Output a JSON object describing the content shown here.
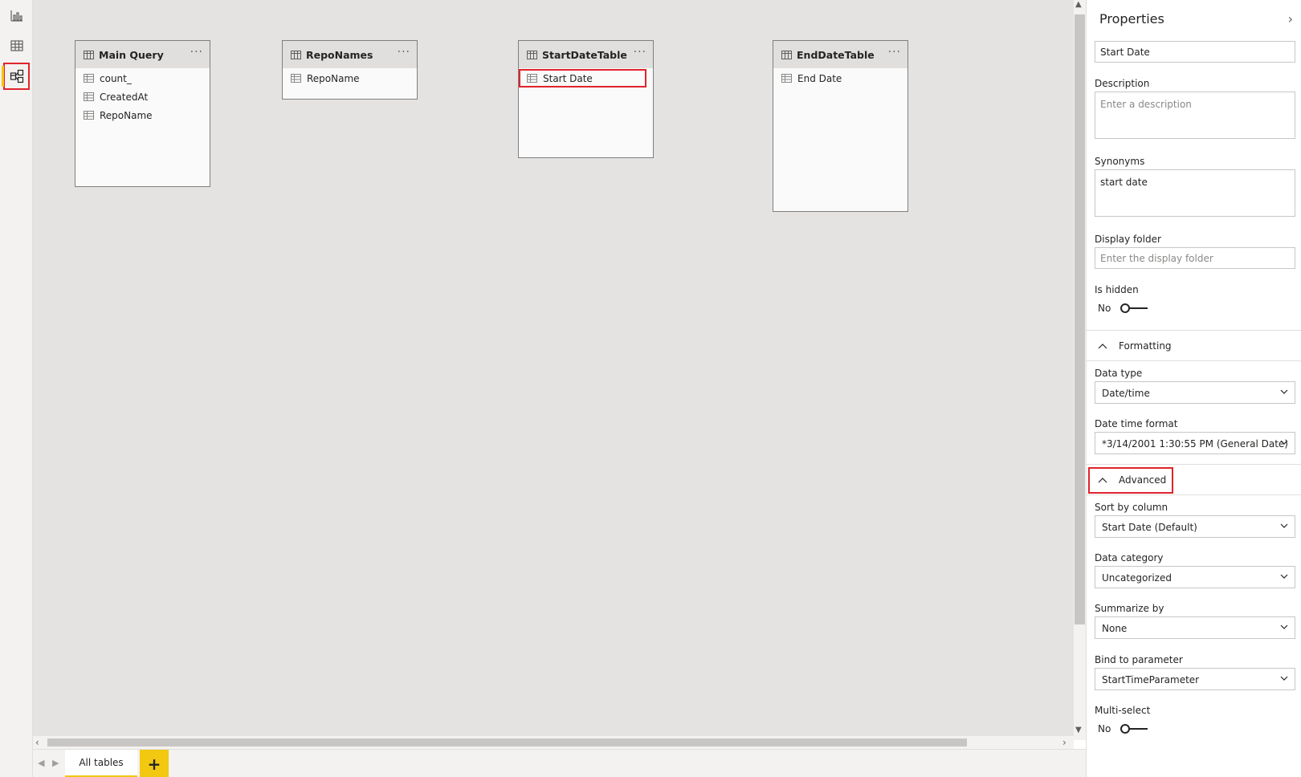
{
  "nav": {
    "items": [
      {
        "name": "report-view",
        "icon": "bar-chart-icon"
      },
      {
        "name": "data-view",
        "icon": "table-grid-icon"
      },
      {
        "name": "model-view",
        "icon": "model-diagram-icon",
        "active": true
      }
    ]
  },
  "tables": [
    {
      "name": "Main Query",
      "fields": [
        "count_",
        "CreatedAt",
        "RepoName"
      ]
    },
    {
      "name": "RepoNames",
      "fields": [
        "RepoName"
      ]
    },
    {
      "name": "StartDateTable",
      "fields": [
        "Start Date"
      ],
      "selected_field": "Start Date"
    },
    {
      "name": "EndDateTable",
      "fields": [
        "End Date"
      ]
    }
  ],
  "card_more_label": "···",
  "tabs": {
    "all_tables": "All tables",
    "add_label": "+"
  },
  "properties": {
    "title": "Properties",
    "name_value": "Start Date",
    "description_label": "Description",
    "description_placeholder": "Enter a description",
    "synonyms_label": "Synonyms",
    "synonyms_value": "start date",
    "display_folder_label": "Display folder",
    "display_folder_placeholder": "Enter the display folder",
    "is_hidden_label": "Is hidden",
    "is_hidden_value": "No",
    "formatting_section": "Formatting",
    "data_type_label": "Data type",
    "data_type_value": "Date/time",
    "date_time_format_label": "Date time format",
    "date_time_format_value": "*3/14/2001 1:30:55 PM (General Date)",
    "advanced_section": "Advanced",
    "sort_by_label": "Sort by column",
    "sort_by_value": "Start Date (Default)",
    "data_category_label": "Data category",
    "data_category_value": "Uncategorized",
    "summarize_by_label": "Summarize by",
    "summarize_by_value": "None",
    "bind_param_label": "Bind to parameter",
    "bind_param_value": "StartTimeParameter",
    "multi_select_label": "Multi-select",
    "multi_select_value": "No"
  },
  "colors": {
    "accent_yellow": "#f2c811",
    "highlight_red": "#e0242c",
    "canvas_bg": "#e4e3e2"
  }
}
